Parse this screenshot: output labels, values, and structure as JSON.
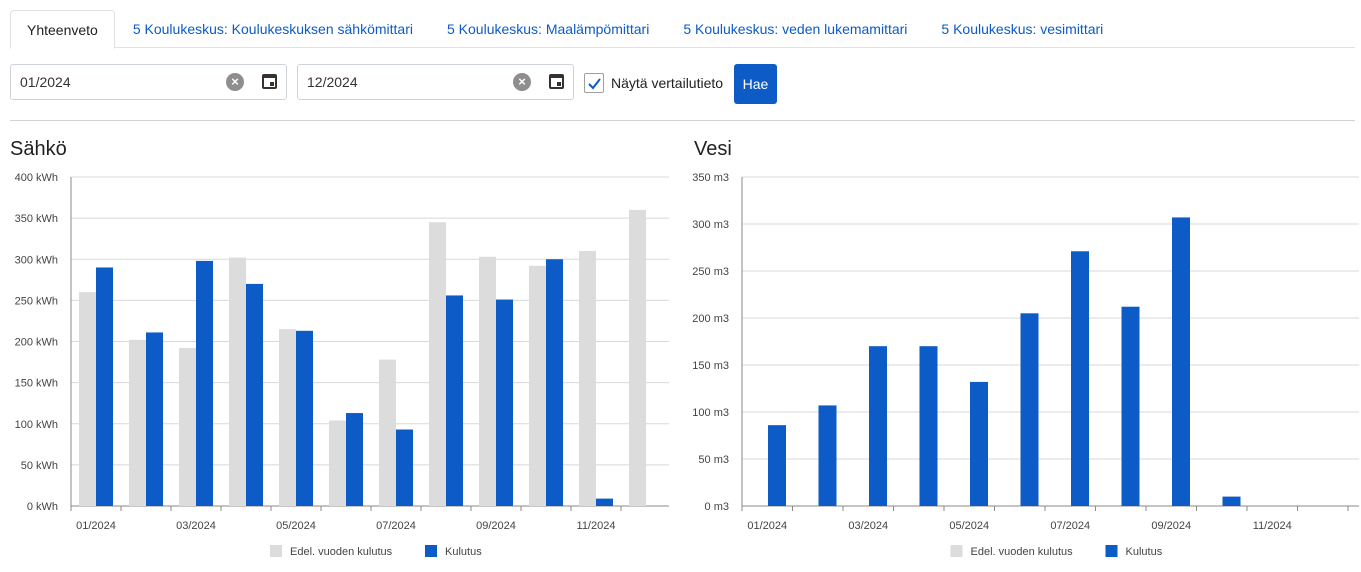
{
  "tabs": [
    {
      "label": "Yhteenveto",
      "active": true
    },
    {
      "label": "5 Koulukeskus: Koulukeskuksen sähkömittari",
      "active": false
    },
    {
      "label": "5 Koulukeskus: Maalämpömittari",
      "active": false
    },
    {
      "label": "5 Koulukeskus: veden lukemamittari",
      "active": false
    },
    {
      "label": "5 Koulukeskus: vesimittari",
      "active": false
    }
  ],
  "filters": {
    "start_date": "01/2024",
    "end_date": "12/2024",
    "compare_label": "Näytä vertailutieto",
    "compare_checked": true,
    "search_label": "Hae"
  },
  "colors": {
    "accent": "#0d5bc6",
    "previous": "#dcdcdc"
  },
  "chart_data": [
    {
      "type": "bar",
      "title": "Sähkö",
      "unit": "kWh",
      "ylim": [
        0,
        400
      ],
      "yticks": [
        0,
        50,
        100,
        150,
        200,
        250,
        300,
        350,
        400
      ],
      "ytick_labels": [
        "0 kWh",
        "50 kWh",
        "100 kWh",
        "150 kWh",
        "200 kWh",
        "250 kWh",
        "300 kWh",
        "350 kWh",
        "400 kWh"
      ],
      "categories": [
        "01/2024",
        "02/2024",
        "03/2024",
        "04/2024",
        "05/2024",
        "06/2024",
        "07/2024",
        "08/2024",
        "09/2024",
        "10/2024",
        "11/2024",
        "12/2024"
      ],
      "xtick_labels": [
        "01/2024",
        "",
        "03/2024",
        "",
        "05/2024",
        "",
        "07/2024",
        "",
        "09/2024",
        "",
        "11/2024",
        ""
      ],
      "series": [
        {
          "name": "Edel. vuoden kulutus",
          "color": "#dcdcdc",
          "values": [
            260,
            202,
            192,
            302,
            215,
            104,
            178,
            345,
            303,
            292,
            310,
            360
          ]
        },
        {
          "name": "Kulutus",
          "color": "#0d5bc6",
          "values": [
            290,
            211,
            298,
            270,
            213,
            113,
            93,
            256,
            251,
            300,
            9,
            null
          ]
        }
      ],
      "grid": true,
      "legend": "bottom"
    },
    {
      "type": "bar",
      "title": "Vesi",
      "unit": "m3",
      "ylim": [
        0,
        350
      ],
      "yticks": [
        0,
        50,
        100,
        150,
        200,
        250,
        300,
        350
      ],
      "ytick_labels": [
        "0 m3",
        "50 m3",
        "100 m3",
        "150 m3",
        "200 m3",
        "250 m3",
        "300 m3",
        "350 m3"
      ],
      "categories": [
        "01/2024",
        "02/2024",
        "03/2024",
        "04/2024",
        "05/2024",
        "06/2024",
        "07/2024",
        "08/2024",
        "09/2024",
        "10/2024",
        "11/2024",
        "12/2024"
      ],
      "xtick_labels": [
        "01/2024",
        "",
        "03/2024",
        "",
        "05/2024",
        "",
        "07/2024",
        "",
        "09/2024",
        "",
        "11/2024",
        ""
      ],
      "series": [
        {
          "name": "Edel. vuoden kulutus",
          "color": "#dcdcdc",
          "values": [
            null,
            null,
            null,
            null,
            null,
            null,
            null,
            null,
            null,
            null,
            null,
            null
          ]
        },
        {
          "name": "Kulutus",
          "color": "#0d5bc6",
          "values": [
            86,
            107,
            170,
            170,
            132,
            205,
            271,
            212,
            307,
            10,
            null,
            null
          ]
        }
      ],
      "grid": true,
      "legend": "bottom"
    }
  ]
}
